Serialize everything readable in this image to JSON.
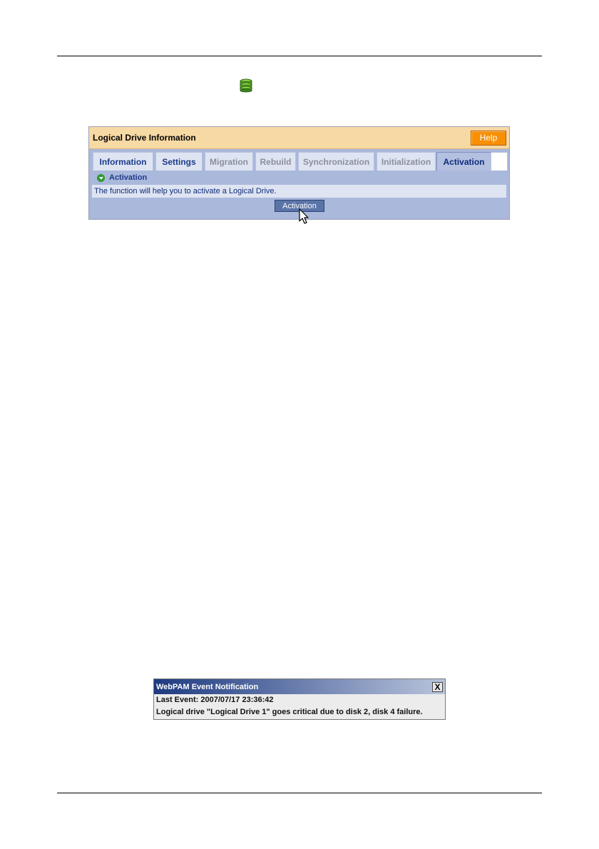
{
  "panel": {
    "title": "Logical Drive Information",
    "help_label": "Help",
    "tabs": [
      {
        "label": "Information",
        "state": "enabled"
      },
      {
        "label": "Settings",
        "state": "enabled"
      },
      {
        "label": "Migration",
        "state": "disabled"
      },
      {
        "label": "Rebuild",
        "state": "disabled"
      },
      {
        "label": "Synchronization",
        "state": "disabled"
      },
      {
        "label": "Initialization",
        "state": "disabled"
      },
      {
        "label": "Activation",
        "state": "active"
      }
    ],
    "section_label": "Activation",
    "description": "The function will help you to activate a Logical Drive.",
    "action_button": "Activation"
  },
  "notification": {
    "title": "WebPAM Event Notification",
    "close_glyph": "X",
    "last_event": "Last Event: 2007/07/17 23:36:42",
    "message": "Logical drive \"Logical Drive 1\" goes critical due to  disk 2, disk 4 failure."
  },
  "colors": {
    "header_bg": "#f7d9a4",
    "panel_bg": "#aab8dc",
    "help_orange": "#f88f04",
    "tab_text": "#1a3a8a",
    "notify_title": "#1e3a80"
  },
  "icons": {
    "logical-drive": "green stacked disks",
    "section-arrow": "green circle with down arrow",
    "cursor": "mouse pointer"
  }
}
